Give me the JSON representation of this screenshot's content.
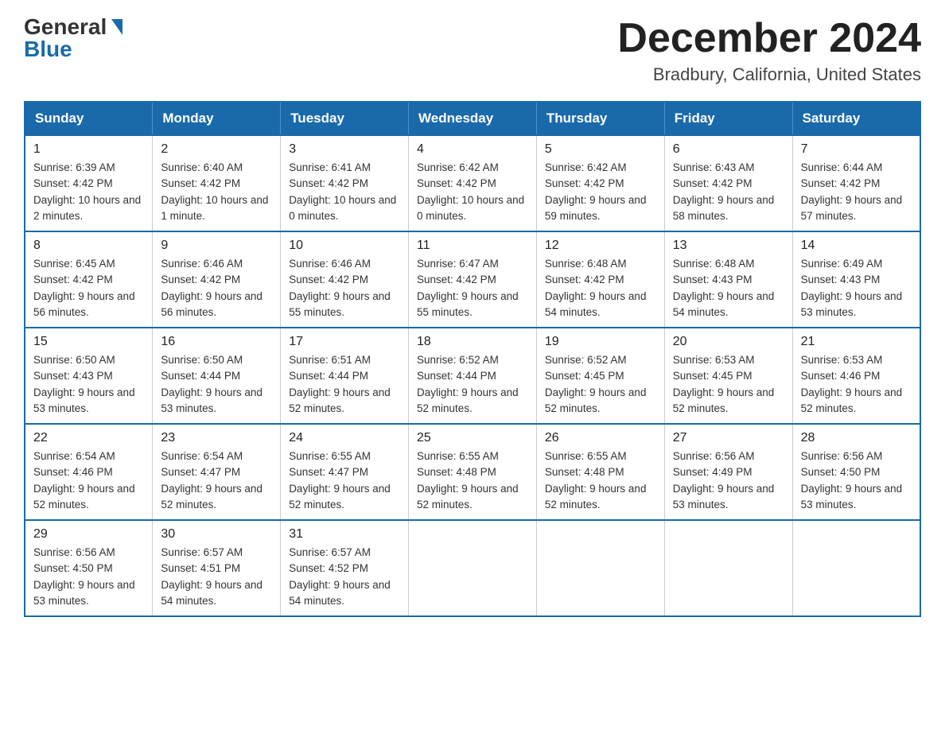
{
  "header": {
    "logo_general": "General",
    "logo_blue": "Blue",
    "month_title": "December 2024",
    "location": "Bradbury, California, United States"
  },
  "days_of_week": [
    "Sunday",
    "Monday",
    "Tuesday",
    "Wednesday",
    "Thursday",
    "Friday",
    "Saturday"
  ],
  "weeks": [
    [
      {
        "day": "1",
        "sunrise": "6:39 AM",
        "sunset": "4:42 PM",
        "daylight": "10 hours and 2 minutes."
      },
      {
        "day": "2",
        "sunrise": "6:40 AM",
        "sunset": "4:42 PM",
        "daylight": "10 hours and 1 minute."
      },
      {
        "day": "3",
        "sunrise": "6:41 AM",
        "sunset": "4:42 PM",
        "daylight": "10 hours and 0 minutes."
      },
      {
        "day": "4",
        "sunrise": "6:42 AM",
        "sunset": "4:42 PM",
        "daylight": "10 hours and 0 minutes."
      },
      {
        "day": "5",
        "sunrise": "6:42 AM",
        "sunset": "4:42 PM",
        "daylight": "9 hours and 59 minutes."
      },
      {
        "day": "6",
        "sunrise": "6:43 AM",
        "sunset": "4:42 PM",
        "daylight": "9 hours and 58 minutes."
      },
      {
        "day": "7",
        "sunrise": "6:44 AM",
        "sunset": "4:42 PM",
        "daylight": "9 hours and 57 minutes."
      }
    ],
    [
      {
        "day": "8",
        "sunrise": "6:45 AM",
        "sunset": "4:42 PM",
        "daylight": "9 hours and 56 minutes."
      },
      {
        "day": "9",
        "sunrise": "6:46 AM",
        "sunset": "4:42 PM",
        "daylight": "9 hours and 56 minutes."
      },
      {
        "day": "10",
        "sunrise": "6:46 AM",
        "sunset": "4:42 PM",
        "daylight": "9 hours and 55 minutes."
      },
      {
        "day": "11",
        "sunrise": "6:47 AM",
        "sunset": "4:42 PM",
        "daylight": "9 hours and 55 minutes."
      },
      {
        "day": "12",
        "sunrise": "6:48 AM",
        "sunset": "4:42 PM",
        "daylight": "9 hours and 54 minutes."
      },
      {
        "day": "13",
        "sunrise": "6:48 AM",
        "sunset": "4:43 PM",
        "daylight": "9 hours and 54 minutes."
      },
      {
        "day": "14",
        "sunrise": "6:49 AM",
        "sunset": "4:43 PM",
        "daylight": "9 hours and 53 minutes."
      }
    ],
    [
      {
        "day": "15",
        "sunrise": "6:50 AM",
        "sunset": "4:43 PM",
        "daylight": "9 hours and 53 minutes."
      },
      {
        "day": "16",
        "sunrise": "6:50 AM",
        "sunset": "4:44 PM",
        "daylight": "9 hours and 53 minutes."
      },
      {
        "day": "17",
        "sunrise": "6:51 AM",
        "sunset": "4:44 PM",
        "daylight": "9 hours and 52 minutes."
      },
      {
        "day": "18",
        "sunrise": "6:52 AM",
        "sunset": "4:44 PM",
        "daylight": "9 hours and 52 minutes."
      },
      {
        "day": "19",
        "sunrise": "6:52 AM",
        "sunset": "4:45 PM",
        "daylight": "9 hours and 52 minutes."
      },
      {
        "day": "20",
        "sunrise": "6:53 AM",
        "sunset": "4:45 PM",
        "daylight": "9 hours and 52 minutes."
      },
      {
        "day": "21",
        "sunrise": "6:53 AM",
        "sunset": "4:46 PM",
        "daylight": "9 hours and 52 minutes."
      }
    ],
    [
      {
        "day": "22",
        "sunrise": "6:54 AM",
        "sunset": "4:46 PM",
        "daylight": "9 hours and 52 minutes."
      },
      {
        "day": "23",
        "sunrise": "6:54 AM",
        "sunset": "4:47 PM",
        "daylight": "9 hours and 52 minutes."
      },
      {
        "day": "24",
        "sunrise": "6:55 AM",
        "sunset": "4:47 PM",
        "daylight": "9 hours and 52 minutes."
      },
      {
        "day": "25",
        "sunrise": "6:55 AM",
        "sunset": "4:48 PM",
        "daylight": "9 hours and 52 minutes."
      },
      {
        "day": "26",
        "sunrise": "6:55 AM",
        "sunset": "4:48 PM",
        "daylight": "9 hours and 52 minutes."
      },
      {
        "day": "27",
        "sunrise": "6:56 AM",
        "sunset": "4:49 PM",
        "daylight": "9 hours and 53 minutes."
      },
      {
        "day": "28",
        "sunrise": "6:56 AM",
        "sunset": "4:50 PM",
        "daylight": "9 hours and 53 minutes."
      }
    ],
    [
      {
        "day": "29",
        "sunrise": "6:56 AM",
        "sunset": "4:50 PM",
        "daylight": "9 hours and 53 minutes."
      },
      {
        "day": "30",
        "sunrise": "6:57 AM",
        "sunset": "4:51 PM",
        "daylight": "9 hours and 54 minutes."
      },
      {
        "day": "31",
        "sunrise": "6:57 AM",
        "sunset": "4:52 PM",
        "daylight": "9 hours and 54 minutes."
      },
      null,
      null,
      null,
      null
    ]
  ]
}
